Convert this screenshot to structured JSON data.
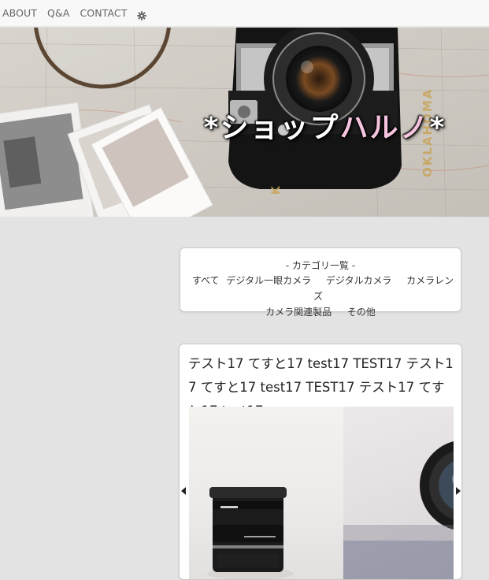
{
  "nav": {
    "items": [
      "ABOUT",
      "Q&A",
      "CONTACT"
    ],
    "settings_icon": "gear-icon"
  },
  "hero": {
    "title_part1": "*ショップ",
    "title_part2": "ハルノ",
    "title_part3": "*",
    "accent_color": "#f6c4df"
  },
  "categories": {
    "heading": "- カテゴリ一覧 -",
    "row1": [
      "すべて",
      "デジタル一眼カメラ",
      "デジタルカメラ",
      "カメラレンズ"
    ],
    "row2": [
      "カメラ関連製品",
      "その他"
    ]
  },
  "post": {
    "title": "テスト17 てすと17 test17 TEST17 テスト17 てすと17 test17 TEST17 テスト17 てすと17 test17…"
  }
}
